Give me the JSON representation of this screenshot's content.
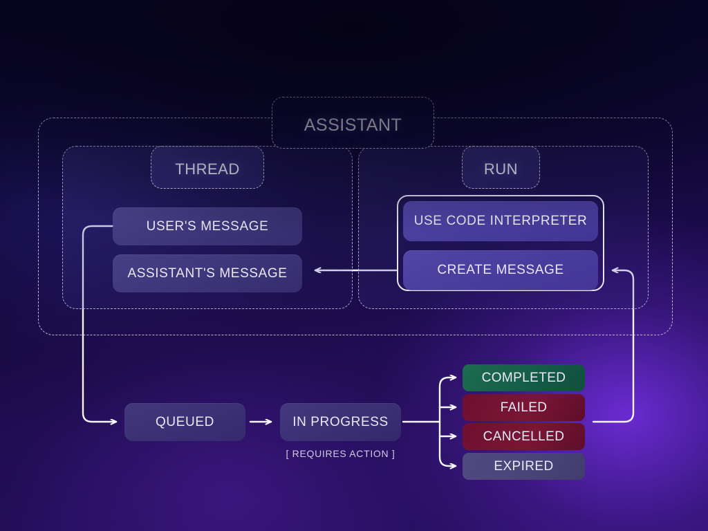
{
  "diagram": {
    "title": "Assistant",
    "panels": {
      "thread": {
        "title": "Thread"
      },
      "run": {
        "title": "Run"
      }
    },
    "thread_messages": [
      {
        "label": "USER'S MESSAGE"
      },
      {
        "label": "ASSISTANT'S MESSAGE"
      }
    ],
    "run_actions": [
      {
        "label": "USE CODE INTERPRETER"
      },
      {
        "label": "CREATE MESSAGE"
      }
    ],
    "lifecycle": [
      {
        "label": "QUEUED"
      },
      {
        "label": "IN PROGRESS"
      }
    ],
    "lifecycle_caption": "[ REQUIRES ACTION ]",
    "terminal_states": [
      {
        "label": "COMPLETED",
        "color": "#155d47"
      },
      {
        "label": "FAILED",
        "color": "#7a1634"
      },
      {
        "label": "CANCELLED",
        "color": "#7a1634"
      },
      {
        "label": "EXPIRED",
        "color": "#4a4478"
      }
    ],
    "colors": {
      "background_top": "#080425",
      "background_bottom": "#2a1070",
      "glow": "#6e2dd7",
      "stroke": "#f5f5ff",
      "dashed_stroke": "#e1e1f5",
      "text": "#e9e8f6",
      "completed": "#155d47",
      "failed": "#7a1634",
      "cancelled": "#7a1634",
      "expired": "#4a4478"
    }
  }
}
